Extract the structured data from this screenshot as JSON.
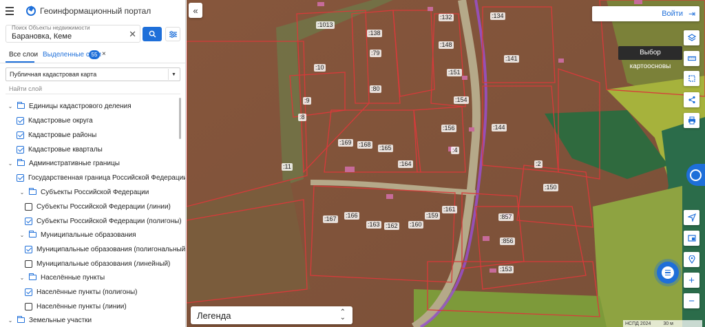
{
  "app": {
    "title": "Геоинформационный портал"
  },
  "search": {
    "label": "Поиск Объекты недвижимости",
    "value": "Барановка, Кеме"
  },
  "tabs": {
    "all_layers": "Все слои",
    "selected_layers": "Выделенные слои",
    "selected_count": "55",
    "close_symbol": "×"
  },
  "basemap_select": {
    "value": "Публичная кадастровая карта",
    "arrow": "▼"
  },
  "find_layer": "Найти слой",
  "tree": [
    {
      "type": "folder",
      "label": "Единицы кадастрового деления",
      "expanded": true,
      "indent": 0
    },
    {
      "type": "checkbox",
      "label": "Кадастровые округа",
      "checked": true,
      "indent": 1
    },
    {
      "type": "checkbox",
      "label": "Кадастровые районы",
      "checked": true,
      "indent": 1
    },
    {
      "type": "checkbox",
      "label": "Кадастровые кварталы",
      "checked": true,
      "indent": 1
    },
    {
      "type": "folder",
      "label": "Административные границы",
      "expanded": true,
      "indent": 0
    },
    {
      "type": "checkbox",
      "label": "Государственная граница Российской Федерации",
      "checked": true,
      "indent": 1
    },
    {
      "type": "folder",
      "label": "Субъекты Российской Федерации",
      "expanded": true,
      "indent": 1
    },
    {
      "type": "checkbox",
      "label": "Субъекты Российской Федерации (линии)",
      "checked": false,
      "indent": 2
    },
    {
      "type": "checkbox",
      "label": "Субъекты Российской Федерации (полигоны)",
      "checked": true,
      "indent": 2
    },
    {
      "type": "folder",
      "label": "Муниципальные образования",
      "expanded": true,
      "indent": 1
    },
    {
      "type": "checkbox",
      "label": "Муниципальные образования (полигональный)",
      "checked": true,
      "indent": 2
    },
    {
      "type": "checkbox",
      "label": "Муниципальные образования (линейный)",
      "checked": false,
      "indent": 2
    },
    {
      "type": "folder",
      "label": "Населённые пункты",
      "expanded": true,
      "indent": 1
    },
    {
      "type": "checkbox",
      "label": "Населённые пункты (полигоны)",
      "checked": true,
      "indent": 2
    },
    {
      "type": "checkbox",
      "label": "Населённые пункты (линии)",
      "checked": false,
      "indent": 2
    },
    {
      "type": "folder",
      "label": "Земельные участки",
      "expanded": true,
      "indent": 0
    }
  ],
  "map": {
    "login_label": "Войти",
    "basemap_tooltip": "Выбор картоосновы",
    "legend_label": "Легенда",
    "scale_text": "НСПД 2024",
    "scale_distance": "30 м",
    "parcels": [
      ":1013",
      ":138",
      ":79",
      ":80",
      ":10",
      ":9",
      ":8",
      ":11",
      ":132",
      ":148",
      ":151",
      ":154",
      ":156",
      ":4",
      ":134",
      ":141",
      ":144",
      ":169",
      ":168",
      ":165",
      ":164",
      ":2",
      ":150",
      ":167",
      ":166",
      ":163",
      ":162",
      ":160",
      ":159",
      ":161",
      ":857",
      ":856",
      ":153"
    ]
  },
  "colors": {
    "accent": "#1e6fd9",
    "parcel_border": "#d83a3a",
    "highlight_road": "#9b4fd6"
  },
  "icons": {
    "menu": "hamburger-icon",
    "search": "search-icon",
    "clear": "close-icon",
    "filter": "filter-icon",
    "collapse": "double-chevron-left-icon",
    "login": "login-icon",
    "layers": "layers-icon",
    "ruler": "ruler-icon",
    "select": "select-area-icon",
    "share": "share-icon",
    "print": "printer-icon",
    "locate": "navigation-arrow-icon",
    "compare": "compare-icon",
    "pin": "location-pin-icon",
    "zoom_in": "plus-icon",
    "zoom_out": "minus-icon",
    "chat": "chat-icon"
  }
}
